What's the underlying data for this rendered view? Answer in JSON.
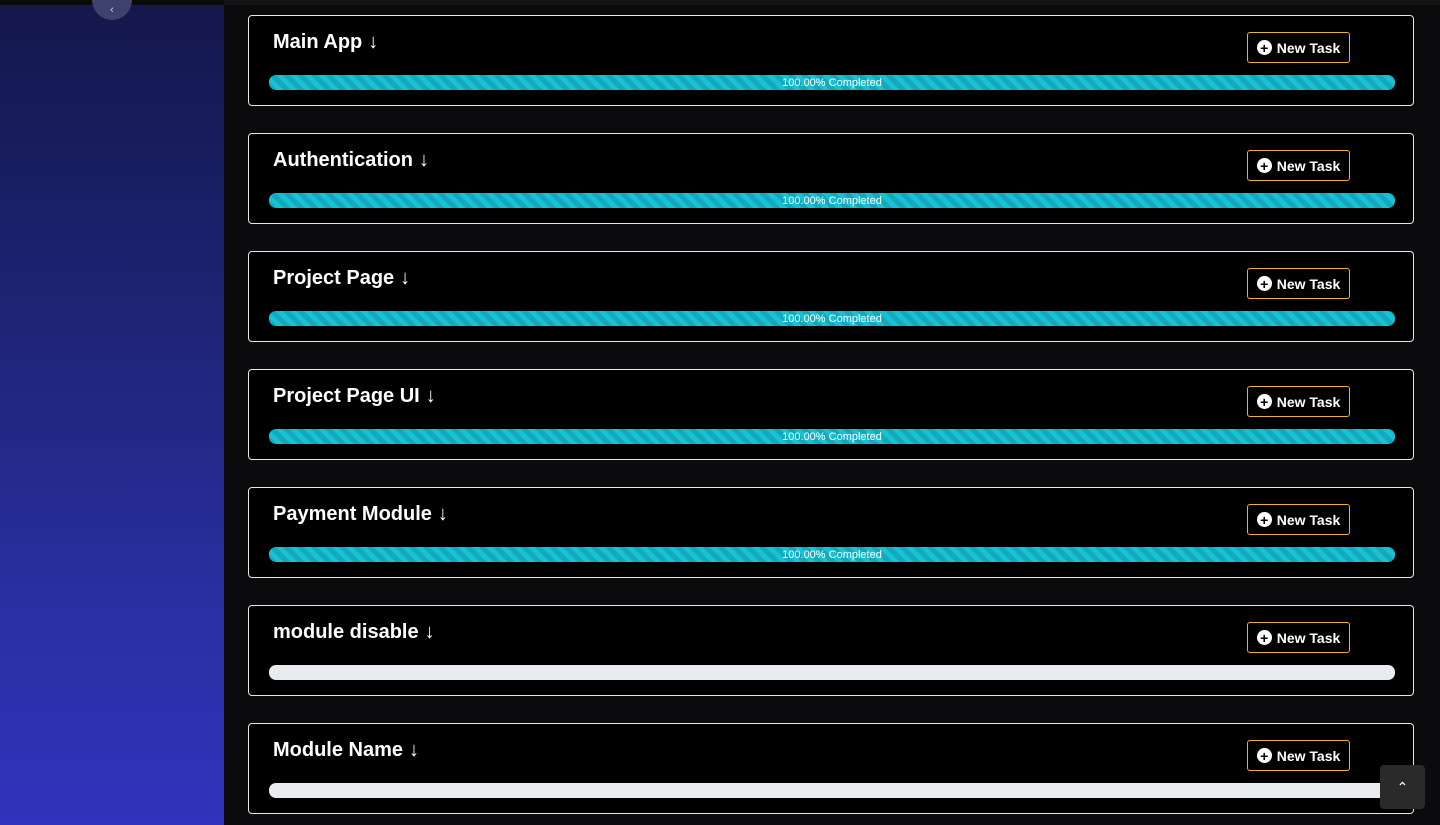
{
  "modules": [
    {
      "title": "Main App",
      "progress_label": "100.00% Completed",
      "progress": 1.0
    },
    {
      "title": "Authentication",
      "progress_label": "100.00% Completed",
      "progress": 1.0
    },
    {
      "title": "Project Page",
      "progress_label": "100.00% Completed",
      "progress": 1.0
    },
    {
      "title": "Project Page UI",
      "progress_label": "100.00% Completed",
      "progress": 1.0
    },
    {
      "title": "Payment Module",
      "progress_label": "100.00% Completed",
      "progress": 1.0
    },
    {
      "title": "module disable",
      "progress_label": "",
      "progress": 0
    },
    {
      "title": "Module Name",
      "progress_label": "",
      "progress": 0
    }
  ],
  "new_task_label": "New Task",
  "icons": {
    "expand": "arrow-down-icon",
    "add": "plus-circle-icon",
    "scroll_top": "chevron-up-icon",
    "sidebar_toggle": "chevron-icon"
  },
  "colors": {
    "accent_progress": "#17c1d6",
    "button_border": "#f0b429",
    "sidebar_top": "#13174a",
    "sidebar_bottom": "#2f33bd"
  }
}
